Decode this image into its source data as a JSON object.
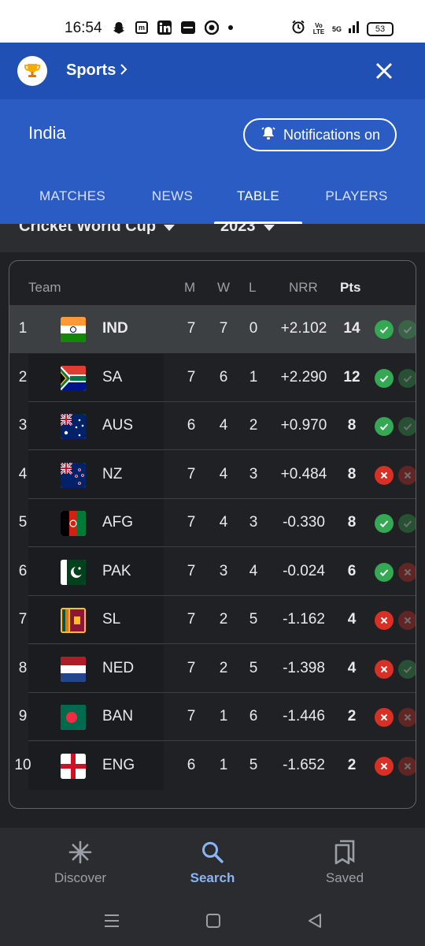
{
  "status_bar": {
    "time": "16:54",
    "network": "5G",
    "volte": "Vo LTE",
    "battery": "53"
  },
  "sports_bar": {
    "title": "Sports",
    "icon": "trophy-icon",
    "close_icon": "close-icon"
  },
  "team_header": {
    "name": "India",
    "notify_label": "Notifications on",
    "tabs": [
      "MATCHES",
      "NEWS",
      "TABLE",
      "PLAYERS"
    ],
    "active_tab": "TABLE"
  },
  "filters": {
    "tournament": "Cricket World Cup",
    "season": "2023"
  },
  "table": {
    "headers": {
      "team": "Team",
      "m": "M",
      "w": "W",
      "l": "L",
      "nrr": "NRR",
      "pts": "Pts"
    },
    "rows": [
      {
        "pos": "1",
        "team": "IND",
        "m": "7",
        "w": "7",
        "l": "0",
        "nrr": "+2.102",
        "pts": "14",
        "form": [
          "W",
          "W"
        ],
        "flag": "india-flag-icon"
      },
      {
        "pos": "2",
        "team": "SA",
        "m": "7",
        "w": "6",
        "l": "1",
        "nrr": "+2.290",
        "pts": "12",
        "form": [
          "W",
          "W"
        ],
        "flag": "south-africa-flag-icon"
      },
      {
        "pos": "3",
        "team": "AUS",
        "m": "6",
        "w": "4",
        "l": "2",
        "nrr": "+0.970",
        "pts": "8",
        "form": [
          "W",
          "W"
        ],
        "flag": "australia-flag-icon"
      },
      {
        "pos": "4",
        "team": "NZ",
        "m": "7",
        "w": "4",
        "l": "3",
        "nrr": "+0.484",
        "pts": "8",
        "form": [
          "L",
          "L"
        ],
        "flag": "new-zealand-flag-icon"
      },
      {
        "pos": "5",
        "team": "AFG",
        "m": "7",
        "w": "4",
        "l": "3",
        "nrr": "-0.330",
        "pts": "8",
        "form": [
          "W",
          "W"
        ],
        "flag": "afghanistan-flag-icon"
      },
      {
        "pos": "6",
        "team": "PAK",
        "m": "7",
        "w": "3",
        "l": "4",
        "nrr": "-0.024",
        "pts": "6",
        "form": [
          "W",
          "L"
        ],
        "flag": "pakistan-flag-icon"
      },
      {
        "pos": "7",
        "team": "SL",
        "m": "7",
        "w": "2",
        "l": "5",
        "nrr": "-1.162",
        "pts": "4",
        "form": [
          "L",
          "L"
        ],
        "flag": "sri-lanka-flag-icon"
      },
      {
        "pos": "8",
        "team": "NED",
        "m": "7",
        "w": "2",
        "l": "5",
        "nrr": "-1.398",
        "pts": "4",
        "form": [
          "L",
          "W"
        ],
        "flag": "netherlands-flag-icon"
      },
      {
        "pos": "9",
        "team": "BAN",
        "m": "7",
        "w": "1",
        "l": "6",
        "nrr": "-1.446",
        "pts": "2",
        "form": [
          "L",
          "L"
        ],
        "flag": "bangladesh-flag-icon"
      },
      {
        "pos": "10",
        "team": "ENG",
        "m": "6",
        "w": "1",
        "l": "5",
        "nrr": "-1.652",
        "pts": "2",
        "form": [
          "L",
          "L"
        ],
        "flag": "england-flag-icon"
      }
    ]
  },
  "bottom_nav": {
    "items": [
      {
        "label": "Discover",
        "icon": "discover-icon"
      },
      {
        "label": "Search",
        "icon": "search-icon"
      },
      {
        "label": "Saved",
        "icon": "saved-icon"
      }
    ],
    "active": "Search"
  },
  "colors": {
    "header_blue": "#2050b3",
    "accent": "#8ab4f8",
    "win": "#34a853",
    "loss": "#d93025"
  }
}
